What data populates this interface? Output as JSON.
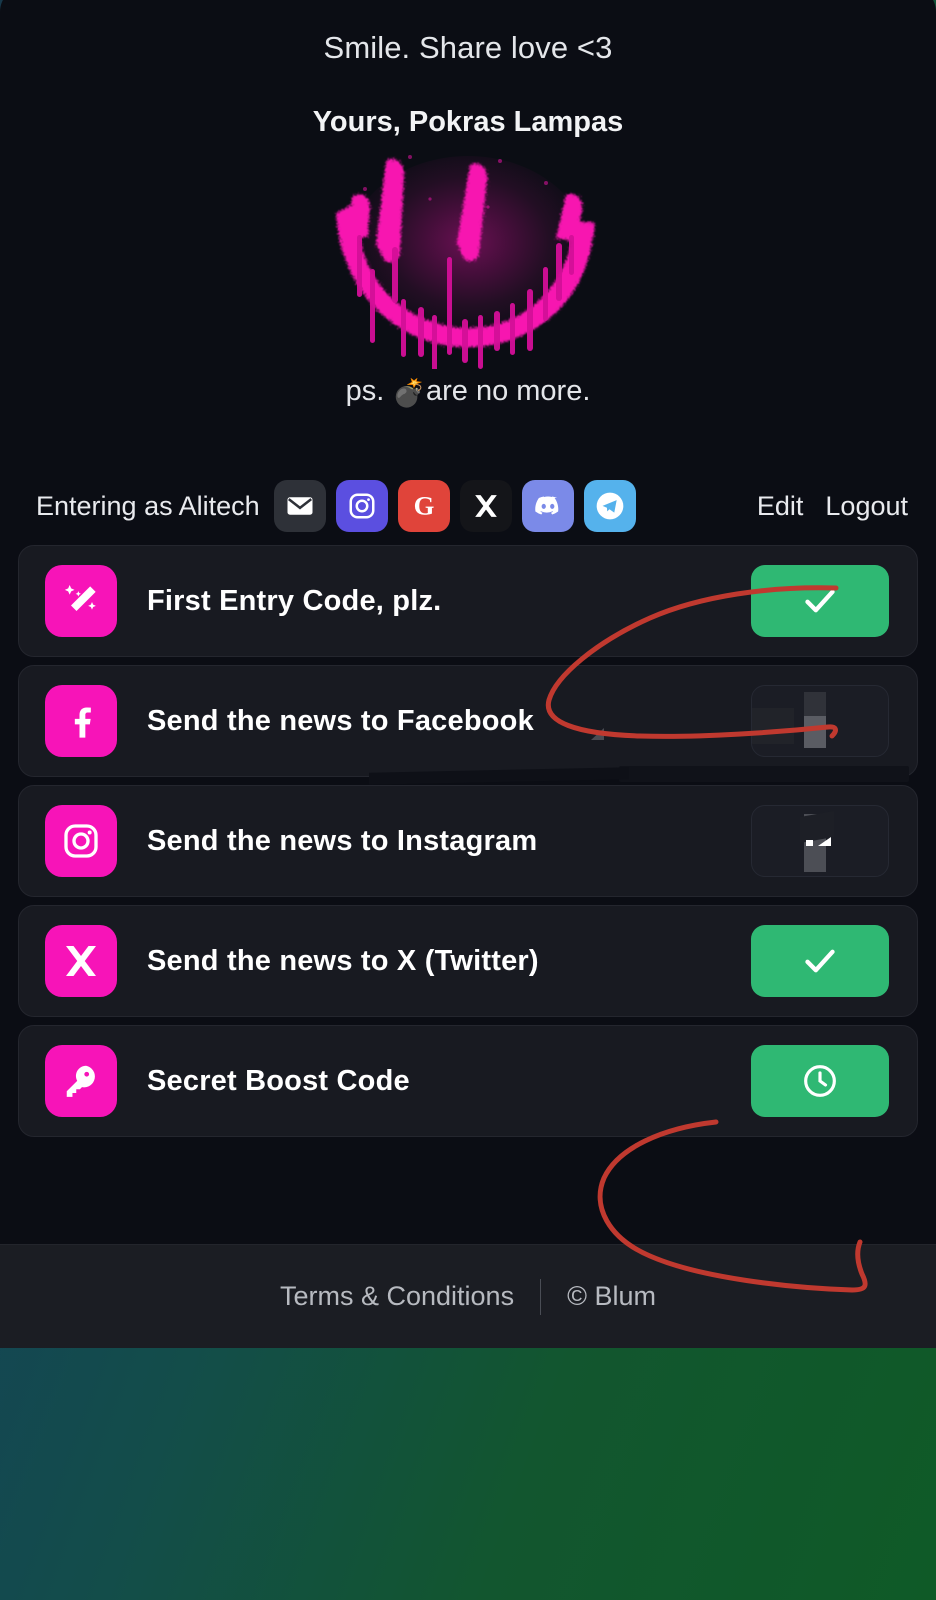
{
  "hero": {
    "line1": "Smile. Share love <3",
    "line2": "Yours, Pokras Lampas",
    "graffiti_alt": "pink-spray-smiley",
    "ps_prefix": "ps. ",
    "ps_emoji": "💣",
    "ps_suffix": "are no more."
  },
  "account": {
    "entering_as": "Entering as Alitech",
    "edit_label": "Edit",
    "logout_label": "Logout",
    "socials": [
      {
        "name": "email-icon",
        "label": "Email",
        "bg": "#2e3138"
      },
      {
        "name": "instagram-icon",
        "label": "Instagram",
        "bg": "#5b4fe0"
      },
      {
        "name": "google-icon",
        "label": "Google",
        "bg": "#e0443a"
      },
      {
        "name": "x-icon",
        "label": "X",
        "bg": "#141519"
      },
      {
        "name": "discord-icon",
        "label": "Discord",
        "bg": "#7b8ae8"
      },
      {
        "name": "telegram-icon",
        "label": "Telegram",
        "bg": "#55b2ec"
      }
    ]
  },
  "tasks": [
    {
      "label": "First Entry Code, plz.",
      "icon": "magic-wand-icon",
      "state": "done",
      "action_glyph": "✓"
    },
    {
      "label": "Send the news to Facebook",
      "icon": "facebook-icon",
      "state": "dim",
      "action_glyph": ""
    },
    {
      "label": "Send the news to Instagram",
      "icon": "instagram-icon",
      "state": "dim",
      "action_glyph": ""
    },
    {
      "label": "Send the news to X (Twitter)",
      "icon": "x-icon",
      "state": "done",
      "action_glyph": "✓"
    },
    {
      "label": "Secret Boost Code",
      "icon": "key-icon",
      "state": "pending",
      "action_glyph": "◴"
    }
  ],
  "footer": {
    "terms_label": "Terms & Conditions",
    "copyright_label": "© Blum"
  },
  "colors": {
    "page_bg": "#0b0d14",
    "card_bg": "#0b0d14",
    "row_bg": "#181a21",
    "accent_magenta": "#f714b8",
    "accent_green": "#2fb873",
    "annotation_red": "#c0392f",
    "graffiti_pink": "#f713b0",
    "footer_bg": "#1b1d23",
    "gradient_from": "#17384a",
    "gradient_to": "#0f5a27"
  }
}
